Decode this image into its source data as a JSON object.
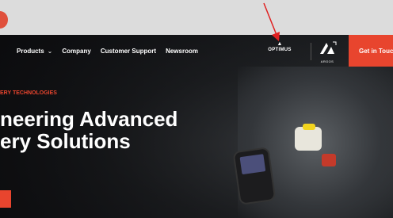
{
  "nav": {
    "items": [
      {
        "label": "Products",
        "has_dropdown": true
      },
      {
        "label": "Company",
        "has_dropdown": false
      },
      {
        "label": "Customer Support",
        "has_dropdown": false
      },
      {
        "label": "Newsroom",
        "has_dropdown": false
      }
    ],
    "optimus_label": "OPTIMUS",
    "argos_label": "ARGOS",
    "cta_label": "Get in Touc"
  },
  "hero": {
    "tag": "ERY TECHNOLOGIES",
    "headline_line1": "neering Advanced",
    "headline_line2": "ery Solutions"
  },
  "colors": {
    "accent": "#e8452e",
    "annotation_arrow": "#e02020"
  }
}
